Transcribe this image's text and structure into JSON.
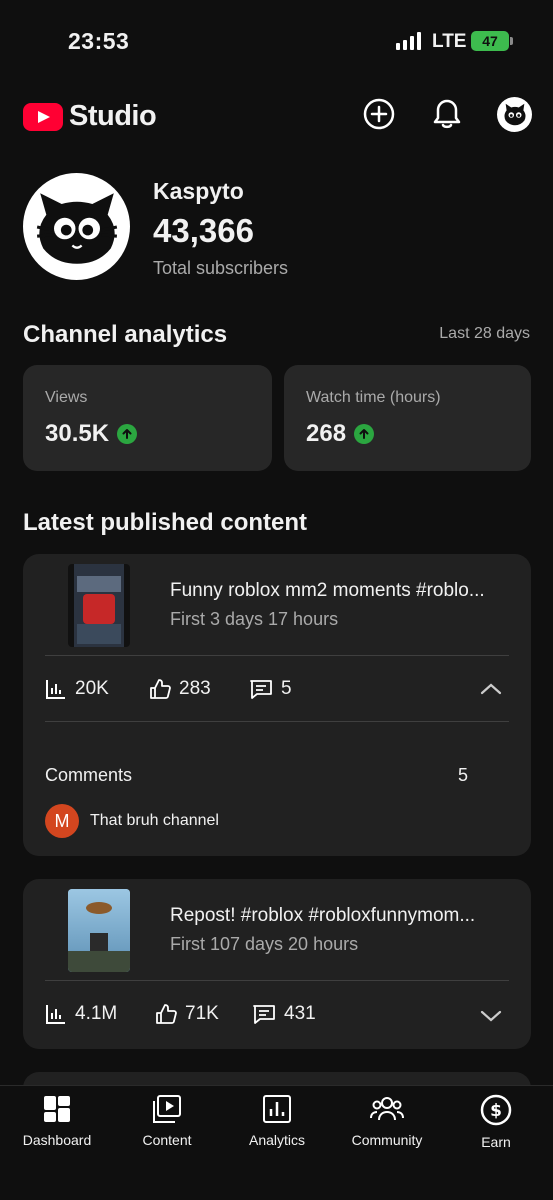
{
  "status_bar": {
    "time": "23:53",
    "network": "LTE",
    "battery": "47"
  },
  "header": {
    "app_name": "Studio"
  },
  "channel": {
    "name": "Kaspyto",
    "subscribers": "43,366",
    "subscribers_label": "Total subscribers"
  },
  "analytics": {
    "title": "Channel analytics",
    "period": "Last 28 days",
    "stats": [
      {
        "label": "Views",
        "value": "30.5K",
        "trend": "up"
      },
      {
        "label": "Watch time (hours)",
        "value": "268",
        "trend": "up"
      }
    ]
  },
  "latest": {
    "title": "Latest published content",
    "items": [
      {
        "title": "Funny roblox mm2 moments #roblo...",
        "subtitle": "First 3 days 17 hours",
        "views": "20K",
        "likes": "283",
        "comments": "5",
        "expanded": true,
        "comments_label": "Comments",
        "comments_count": "5",
        "comment_author_initial": "M",
        "comment_author": "That bruh channel"
      },
      {
        "title": "Repost! #roblox #robloxfunnymom...",
        "subtitle": "First 107 days 20 hours",
        "views": "4.1M",
        "likes": "71K",
        "comments": "431",
        "expanded": false
      }
    ]
  },
  "nav": [
    {
      "label": "Dashboard",
      "icon": "dashboard-icon"
    },
    {
      "label": "Content",
      "icon": "content-icon"
    },
    {
      "label": "Analytics",
      "icon": "analytics-icon"
    },
    {
      "label": "Community",
      "icon": "community-icon"
    },
    {
      "label": "Earn",
      "icon": "earn-icon"
    }
  ],
  "colors": {
    "accent": "#ff0033",
    "trend_up": "#2ba640",
    "card": "#272727",
    "background": "#0f0f0f"
  }
}
